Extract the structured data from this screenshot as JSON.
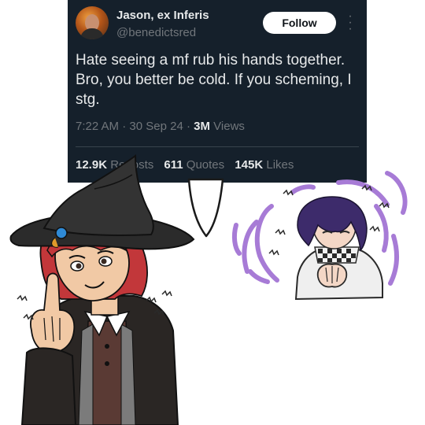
{
  "tweet": {
    "author_name": "Jason, ex Inferis",
    "handle": "@benedictsred",
    "follow_label": "Follow",
    "more_icon": "more-vertical-icon",
    "text": "Hate seeing a mf rub his hands together. Bro, you better be cold. If you scheming, I stg.",
    "time": "7:22 AM",
    "date": "30 Sep 24",
    "views_count": "3M",
    "views_label": "Views",
    "reposts_count": "12.9K",
    "reposts_label": "Reposts",
    "quotes_count": "611",
    "quotes_label": "Quotes",
    "likes_count": "145K",
    "likes_label": "Likes"
  },
  "colors": {
    "tweet_background": "#15202b",
    "text_primary": "#e7e9ea",
    "text_secondary": "#71767b",
    "follow_button": "#ffffff",
    "witch_hat": "#2b2b2b",
    "witch_hair": "#c2373a",
    "scribble_purple": "#a77bd6",
    "boy_hair": "#3d2b6b"
  },
  "drawing": {
    "speech_bubble_tail": "speech-bubble-tail",
    "left_character": "witch-girl-pointing-finger",
    "right_character": "purple-haired-boy-rubbing-hands"
  }
}
